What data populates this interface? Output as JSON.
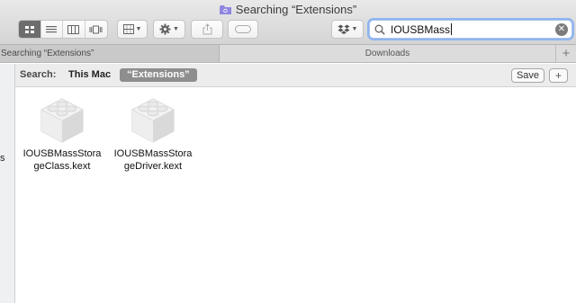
{
  "window": {
    "title": "Searching “Extensions”"
  },
  "toolbar": {
    "view_buttons": [
      "icon-view",
      "list-view",
      "column-view",
      "cover-flow-view"
    ],
    "search": {
      "value": "IOUSBMass",
      "placeholder": "Search"
    }
  },
  "tabs": [
    {
      "label": "Searching “Extensions”",
      "active": true
    },
    {
      "label": "Downloads",
      "active": false
    }
  ],
  "tab_add_label": "+",
  "sidebar": {
    "fragment": "s"
  },
  "scope_bar": {
    "label": "Search:",
    "scopes": [
      "This Mac",
      "“Extensions”"
    ],
    "selected": "“Extensions”",
    "save_label": "Save",
    "add_label": "+"
  },
  "files": [
    {
      "name_line1": "IOUSBMassStora",
      "name_line2": "geClass.kext",
      "icon": "kext-lego-icon"
    },
    {
      "name_line1": "IOUSBMassStora",
      "name_line2": "geDriver.kext",
      "icon": "kext-lego-icon"
    }
  ],
  "colors": {
    "selected_scope_bg": "#8e8e8e",
    "search_focus_ring": "#8fb4ef",
    "folder_icon": "#8f86e0"
  }
}
